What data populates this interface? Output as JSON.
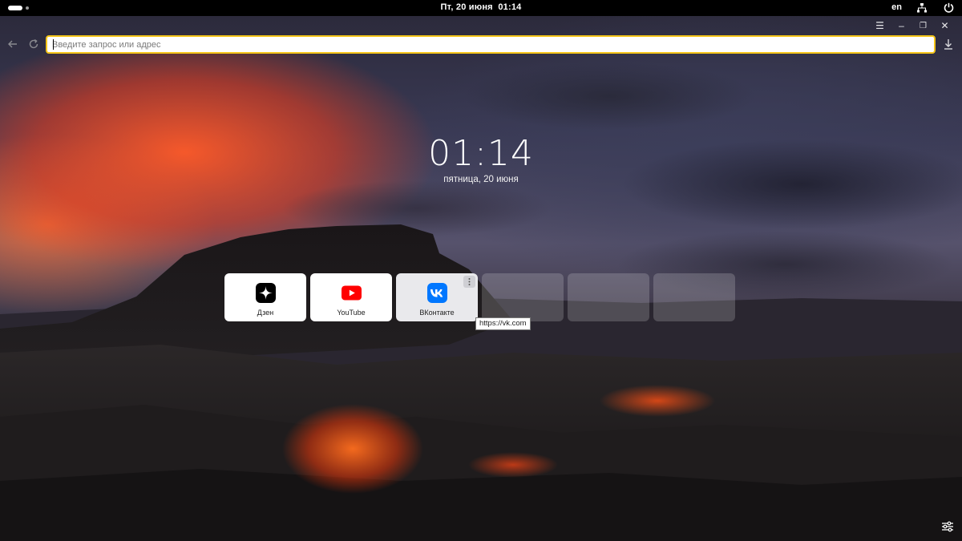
{
  "topbar": {
    "day_date": "Пт, 20 июня",
    "time": "01:14",
    "language": "en"
  },
  "browser": {
    "address_placeholder": "Введите запрос или адрес",
    "address_value": "",
    "accent_color": "#f5c518"
  },
  "newtab": {
    "time": "01:14",
    "date": "пятница, 20 июня",
    "tiles": [
      {
        "label": "Дзен",
        "icon": "dzen-icon"
      },
      {
        "label": "YouTube",
        "icon": "youtube-icon"
      },
      {
        "label": "ВКонтакте",
        "icon": "vk-icon"
      }
    ],
    "empty_tiles": 3,
    "tooltip": "https://vk.com"
  },
  "icons": {
    "menu": "☰",
    "minimize": "‒",
    "restore": "❐",
    "close": "✕"
  }
}
